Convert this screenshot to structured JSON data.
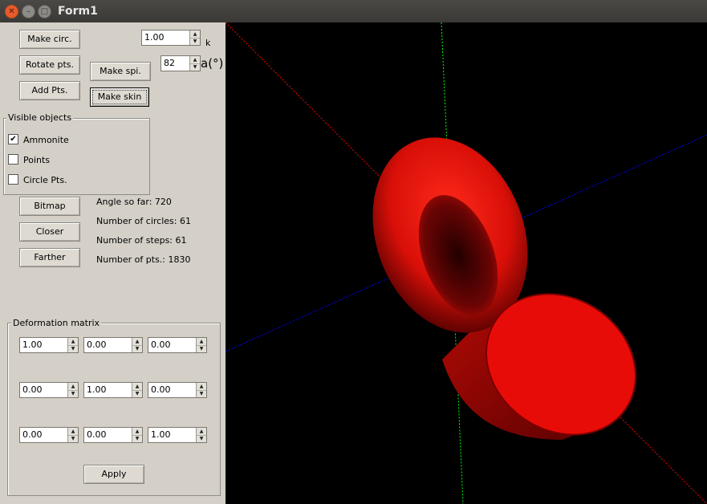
{
  "window": {
    "title": "Form1"
  },
  "controls": {
    "make_circ": "Make circ.",
    "rotate_pts": "Rotate pts.",
    "add_pts": "Add Pts.",
    "make_spi": "Make spi.",
    "make_skin": "Make skin",
    "k_value": "1.00",
    "k_label": "k",
    "a_value": "82",
    "a_label": "a(°)"
  },
  "visible_objects": {
    "title": "Visible objects",
    "items": [
      {
        "label": "Ammonite",
        "checked": true
      },
      {
        "label": "Points",
        "checked": false
      },
      {
        "label": "Circle Pts.",
        "checked": false
      }
    ]
  },
  "view_buttons": {
    "bitmap": "Bitmap",
    "closer": "Closer",
    "farther": "Farther"
  },
  "stats": {
    "angle": "Angle so far: 720",
    "circles": "Number of circles: 61",
    "steps": "Number of steps: 61",
    "pts": "Number of pts.: 1830"
  },
  "deformation": {
    "title": "Deformation matrix",
    "matrix": [
      [
        "1.00",
        "0.00",
        "0.00"
      ],
      [
        "0.00",
        "1.00",
        "0.00"
      ],
      [
        "0.00",
        "0.00",
        "1.00"
      ]
    ],
    "apply": "Apply"
  },
  "colors": {
    "shell": "#ff1a0f",
    "x_axis": "#ff0000",
    "y_axis": "#00ff00",
    "z_axis": "#0000ff",
    "background": "#000000"
  }
}
